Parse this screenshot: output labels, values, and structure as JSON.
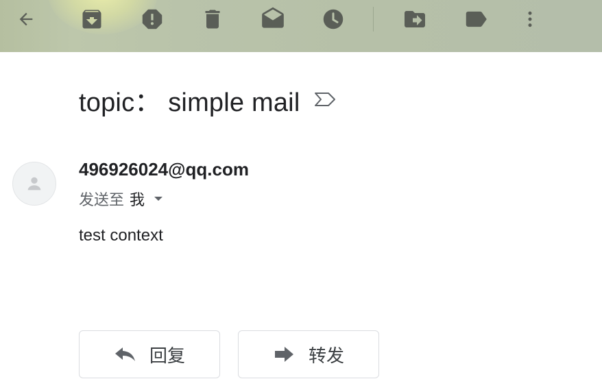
{
  "toolbar": {
    "icons": [
      "back-arrow-icon",
      "archive-icon",
      "report-spam-icon",
      "delete-icon",
      "mark-unread-icon",
      "snooze-icon",
      "move-to-icon",
      "label-icon",
      "more-vert-icon"
    ]
  },
  "message": {
    "subject": "topic： simple mail",
    "sender": "496926024@qq.com",
    "recipient_label": "发送至",
    "recipient_value": "我",
    "body": "test context"
  },
  "actions": {
    "reply_label": "回复",
    "forward_label": "转发"
  },
  "colors": {
    "toolbar_bg": "#b9c3aa",
    "toolbar_icon": "#5a5e57",
    "text_primary": "#202124",
    "text_secondary": "#5f6368",
    "button_border": "#dadce0",
    "avatar_bg": "#f1f3f4"
  }
}
